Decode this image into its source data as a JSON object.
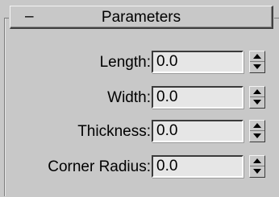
{
  "rollout": {
    "collapse_symbol": "–",
    "title": "Parameters"
  },
  "params": [
    {
      "label": "Length:",
      "value": "0.0"
    },
    {
      "label": "Width:",
      "value": "0.0"
    },
    {
      "label": "Thickness:",
      "value": "0.0"
    },
    {
      "label": "Corner Radius:",
      "value": "0.0"
    }
  ],
  "colors": {
    "panel_bg": "#c8c8c8",
    "field_bg": "#e6e6e6",
    "text": "#000000"
  },
  "icons": {
    "spinner_up": "triangle-up-icon",
    "spinner_down": "triangle-down-icon"
  }
}
